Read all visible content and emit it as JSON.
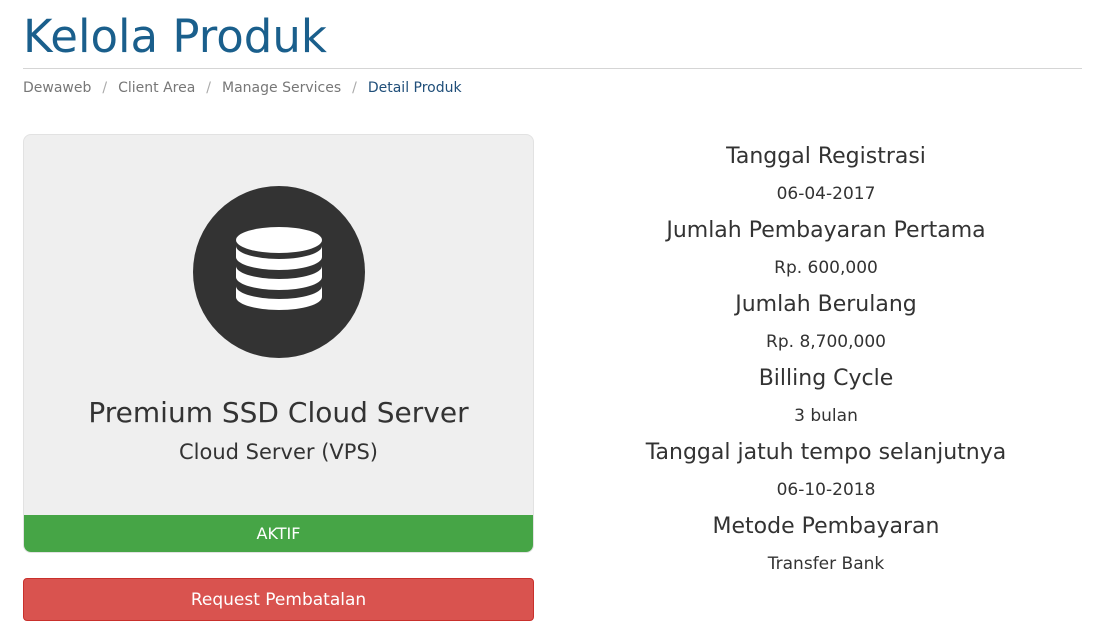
{
  "header": {
    "title": "Kelola Produk"
  },
  "breadcrumb": {
    "items": [
      "Dewaweb",
      "Client Area",
      "Manage Services"
    ],
    "separator": "/",
    "active": "Detail Produk"
  },
  "product": {
    "icon": "database-icon",
    "name": "Premium SSD Cloud Server",
    "group": "Cloud Server (VPS)",
    "status": "AKTIF"
  },
  "actions": {
    "cancel_label": "Request Pembatalan"
  },
  "details": [
    {
      "label": "Tanggal Registrasi",
      "value": "06-04-2017"
    },
    {
      "label": "Jumlah Pembayaran Pertama",
      "value": "Rp. 600,000"
    },
    {
      "label": "Jumlah Berulang",
      "value": "Rp. 8,700,000"
    },
    {
      "label": "Billing Cycle",
      "value": "3 bulan"
    },
    {
      "label": "Tanggal jatuh tempo selanjutnya",
      "value": "06-10-2018"
    },
    {
      "label": "Metode Pembayaran",
      "value": "Transfer Bank"
    }
  ],
  "colors": {
    "title": "#1a5f8c",
    "status_active": "#46a546",
    "danger": "#d9534f",
    "icon_bg": "#333333"
  }
}
